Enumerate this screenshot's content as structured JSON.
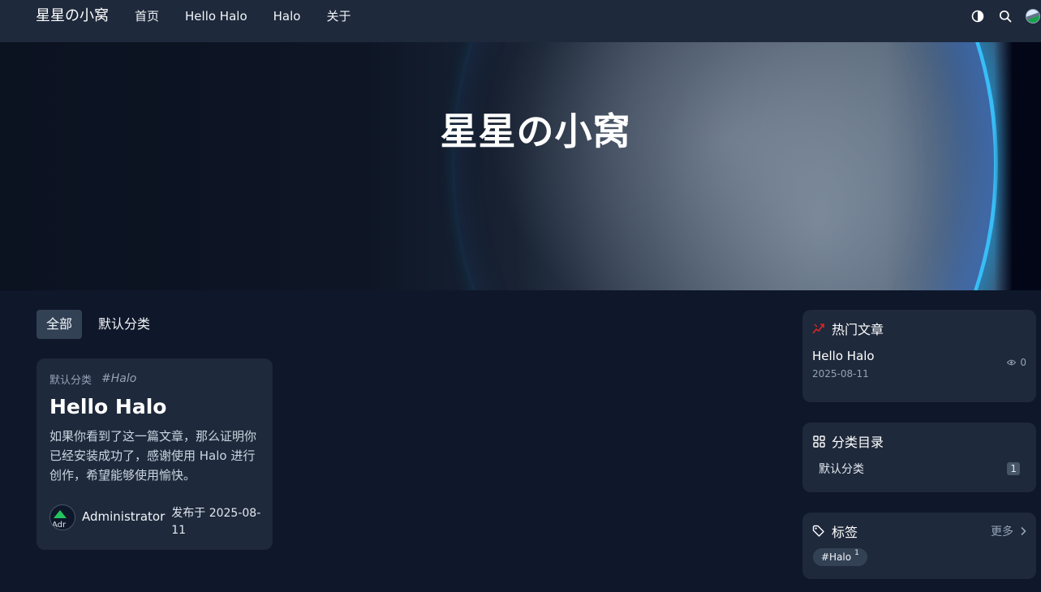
{
  "navbar": {
    "brand": "星星の小窝",
    "items": [
      {
        "label": "首页"
      },
      {
        "label": "Hello Halo"
      },
      {
        "label": "Halo"
      },
      {
        "label": "关于"
      }
    ],
    "icons": [
      "theme-toggle-icon",
      "search-icon",
      "user-avatar"
    ]
  },
  "hero": {
    "title": "星星の小窝"
  },
  "category_tabs": [
    {
      "label": "全部",
      "active": true
    },
    {
      "label": "默认分类",
      "active": false
    }
  ],
  "post": {
    "category": "默认分类",
    "tag": "#Halo",
    "title": "Hello Halo",
    "excerpt": "如果你看到了这一篇文章，那么证明你已经安装成功了，感谢使用 Halo 进行创作，希望能够使用愉快。",
    "author": "Administrator",
    "author_avatar_alt": "Adr",
    "publish_text": "发布于 2025-08-11"
  },
  "sidebar": {
    "hot": {
      "title": "热门文章",
      "items": [
        {
          "title": "Hello Halo",
          "date": "2025-08-11",
          "views": "0"
        }
      ]
    },
    "categories": {
      "title": "分类目录",
      "items": [
        {
          "name": "默认分类",
          "count": "1"
        }
      ]
    },
    "tags": {
      "title": "标签",
      "more": "更多",
      "items": [
        {
          "name": "#Halo",
          "count": "1"
        }
      ]
    }
  },
  "colors": {
    "page_bg": "#0f172a",
    "card_bg": "#1e293b",
    "active_tab": "#334155",
    "hot_icon": "#dc2626"
  }
}
